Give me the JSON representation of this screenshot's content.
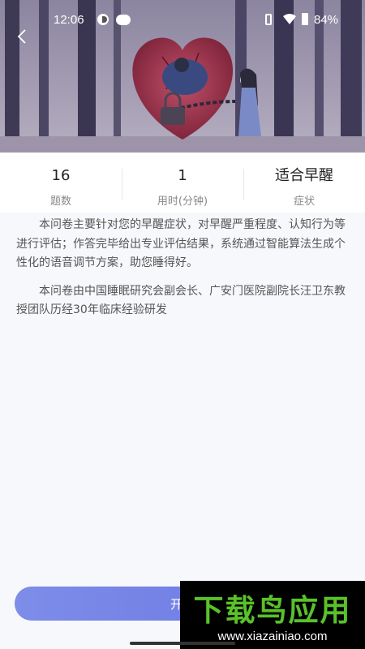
{
  "status_bar": {
    "time": "12:06",
    "battery": "84%"
  },
  "hero": {
    "image": "sad-girl-heart-illustration"
  },
  "stats": [
    {
      "value": "16",
      "label": "题数"
    },
    {
      "value": "1",
      "label": "用时(分钟)"
    },
    {
      "value": "适合早醒",
      "label": "症状"
    }
  ],
  "description": {
    "p1": "本问卷主要针对您的早醒症状，对早醒严重程度、认知行为等进行评估；作答完毕给出专业评估结果，系统通过智能算法生成个性化的语音调节方案，助您睡得好。",
    "p2": "本问卷由中国睡眠研究会副会长、广安门医院副院长汪卫东教授团队历经30年临床经验研发"
  },
  "start_button": {
    "label": "开始"
  },
  "watermark": {
    "title": "下载鸟应用",
    "url": "www.xiazainiao.com"
  },
  "colors": {
    "accent": "#6b74e4",
    "watermark_green": "#59c229"
  }
}
